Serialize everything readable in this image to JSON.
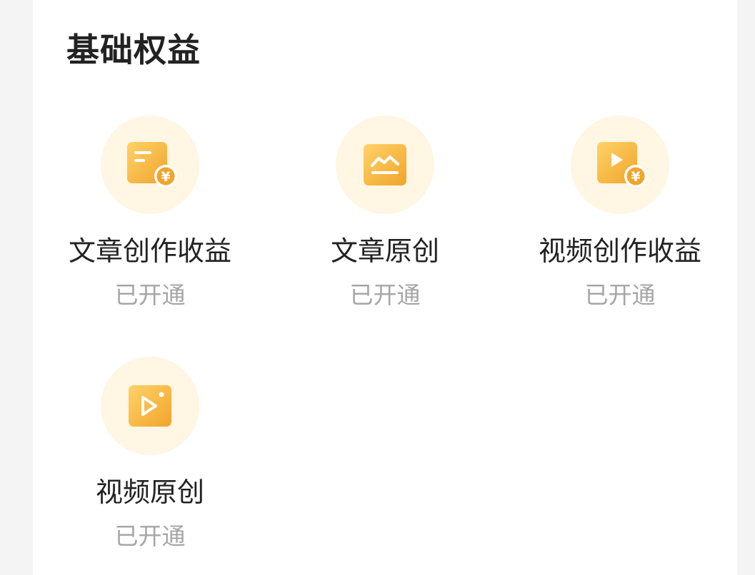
{
  "section": {
    "title": "基础权益"
  },
  "benefits": [
    {
      "label": "文章创作收益",
      "status": "已开通",
      "icon": "article-income-icon"
    },
    {
      "label": "文章原创",
      "status": "已开通",
      "icon": "article-original-icon"
    },
    {
      "label": "视频创作收益",
      "status": "已开通",
      "icon": "video-income-icon"
    },
    {
      "label": "视频原创",
      "status": "已开通",
      "icon": "video-original-icon"
    }
  ],
  "colors": {
    "icon_bg": "#fff6e3",
    "icon_gradient_start": "#ffd26a",
    "icon_gradient_end": "#f0a52a",
    "title": "#222222",
    "status": "#a6a6a6"
  },
  "glyphs": {
    "yuan": "¥"
  }
}
